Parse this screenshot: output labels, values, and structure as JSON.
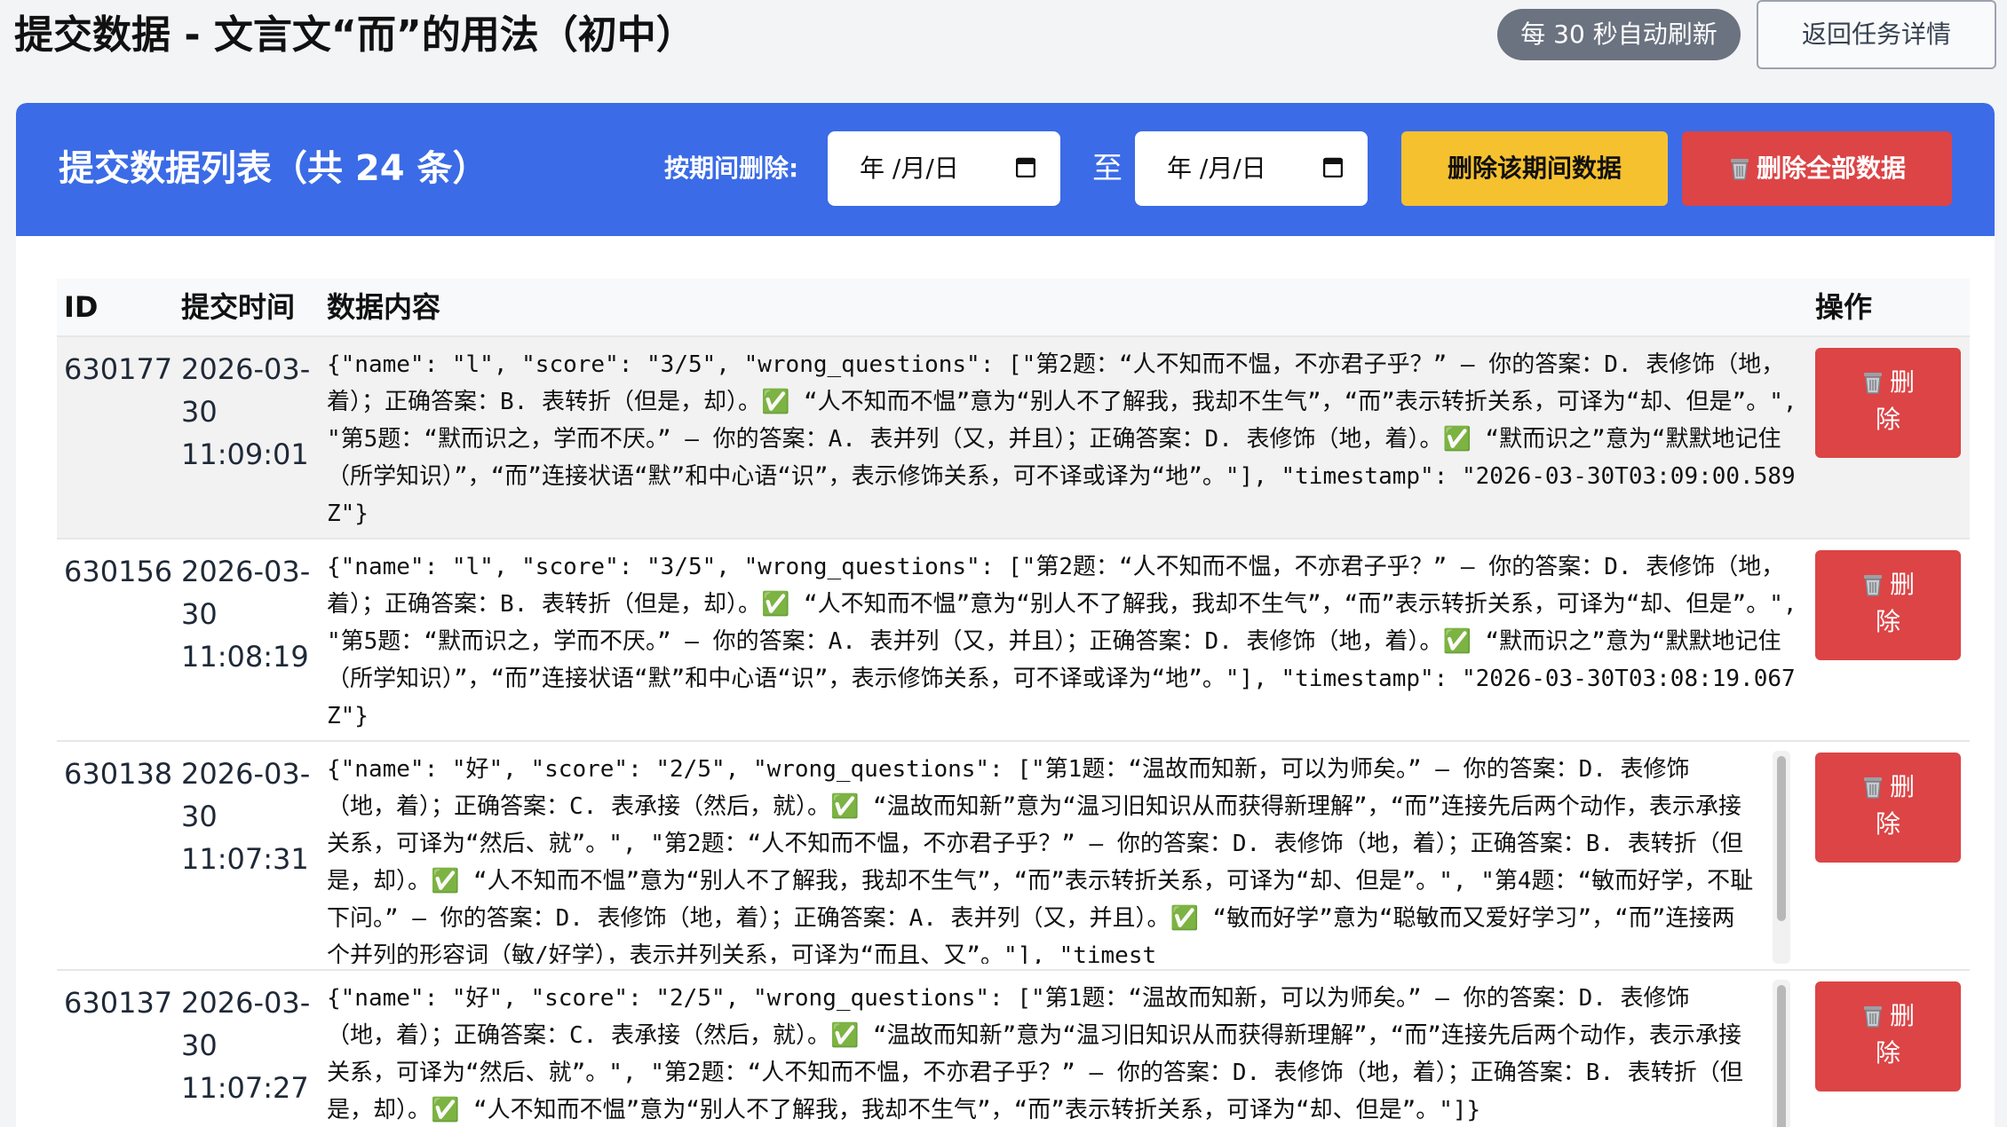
{
  "header": {
    "title": "提交数据 - 文言文“而”的用法（初中）",
    "refresh_badge": "每 30 秒自动刷新",
    "back_button": "返回任务详情"
  },
  "toolbar": {
    "list_title": "提交数据列表（共 24 条）",
    "range_label": "按期间删除:",
    "date_placeholder": "年 /月/日",
    "to_label": "至",
    "delete_range_button": "删除该期间数据",
    "delete_all_button": "删除全部数据"
  },
  "table": {
    "columns": {
      "id": "ID",
      "time": "提交时间",
      "content": "数据内容",
      "op": "操作"
    },
    "delete_label_1": "删",
    "delete_label_2": "除",
    "rows": [
      {
        "id": "630177",
        "date": "2026-03-",
        "date2": "30",
        "time": "11:09:01",
        "content": "{\"name\": \"l\", \"score\": \"3/5\", \"wrong_questions\": [\"第2题：“人不知而不愠，不亦君子乎？” — 你的答案：D. 表修饰（地，着）；正确答案：B. 表转折（但是，却）。✅ “人不知而不愠”意为“别人不了解我，我却不生气”，“而”表示转折关系，可译为“却、但是”。\", \"第5题：“默而识之，学而不厌。” — 你的答案：A. 表并列（又，并且）；正确答案：D. 表修饰（地，着）。✅ “默而识之”意为“默默地记住（所学知识）”，“而”连接状语“默”和中心语“识”，表示修饰关系，可不译或译为“地”。\"], \"timestamp\": \"2026-03-30T03:09:00.589Z\"}"
      },
      {
        "id": "630156",
        "date": "2026-03-",
        "date2": "30",
        "time": "11:08:19",
        "content": "{\"name\": \"l\", \"score\": \"3/5\", \"wrong_questions\": [\"第2题：“人不知而不愠，不亦君子乎？” — 你的答案：D. 表修饰（地，着）；正确答案：B. 表转折（但是，却）。✅ “人不知而不愠”意为“别人不了解我，我却不生气”，“而”表示转折关系，可译为“却、但是”。\", \"第5题：“默而识之，学而不厌。” — 你的答案：A. 表并列（又，并且）；正确答案：D. 表修饰（地，着）。✅ “默而识之”意为“默默地记住（所学知识）”，“而”连接状语“默”和中心语“识”，表示修饰关系，可不译或译为“地”。\"], \"timestamp\": \"2026-03-30T03:08:19.067Z\"}"
      },
      {
        "id": "630138",
        "date": "2026-03-",
        "date2": "30",
        "time": "11:07:31",
        "content": "{\"name\": \"好\", \"score\": \"2/5\", \"wrong_questions\": [\"第1题：“温故而知新，可以为师矣。” — 你的答案：D. 表修饰（地，着）；正确答案：C. 表承接（然后，就）。✅ “温故而知新”意为“温习旧知识从而获得新理解”，“而”连接先后两个动作，表示承接关系，可译为“然后、就”。\", \"第2题：“人不知而不愠，不亦君子乎？” — 你的答案：D. 表修饰（地，着）；正确答案：B. 表转折（但是，却）。✅ “人不知而不愠”意为“别人不了解我，我却不生气”，“而”表示转折关系，可译为“却、但是”。\", \"第4题：“敏而好学，不耻下问。” — 你的答案：D. 表修饰（地，着）；正确答案：A. 表并列（又，并且）。✅ “敏而好学”意为“聪敏而又爱好学习”，“而”连接两个并列的形容词（敏/好学），表示并列关系，可译为“而且、又”。\"], \"timest"
      },
      {
        "id": "630137",
        "date": "2026-03-",
        "date2": "30",
        "time": "11:07:27",
        "content": "{\"name\": \"好\", \"score\": \"2/5\", \"wrong_questions\": [\"第1题：“温故而知新，可以为师矣。” — 你的答案：D. 表修饰（地，着）；正确答案：C. 表承接（然后，就）。✅ “温故而知新”意为“温习旧知识从而获得新理解”，“而”连接先后两个动作，表示承接关系，可译为“然后、就”。\", \"第2题：“人不知而不愠，不亦君子乎？” — 你的答案：D. 表修饰（地，着）；正确答案：B. 表转折（但是，却）。✅ “人不知而不愠”意为“别人不了解我，我却不生气”，“而”表示转折关系，可译为“却、但是”。\"]}"
      }
    ]
  }
}
